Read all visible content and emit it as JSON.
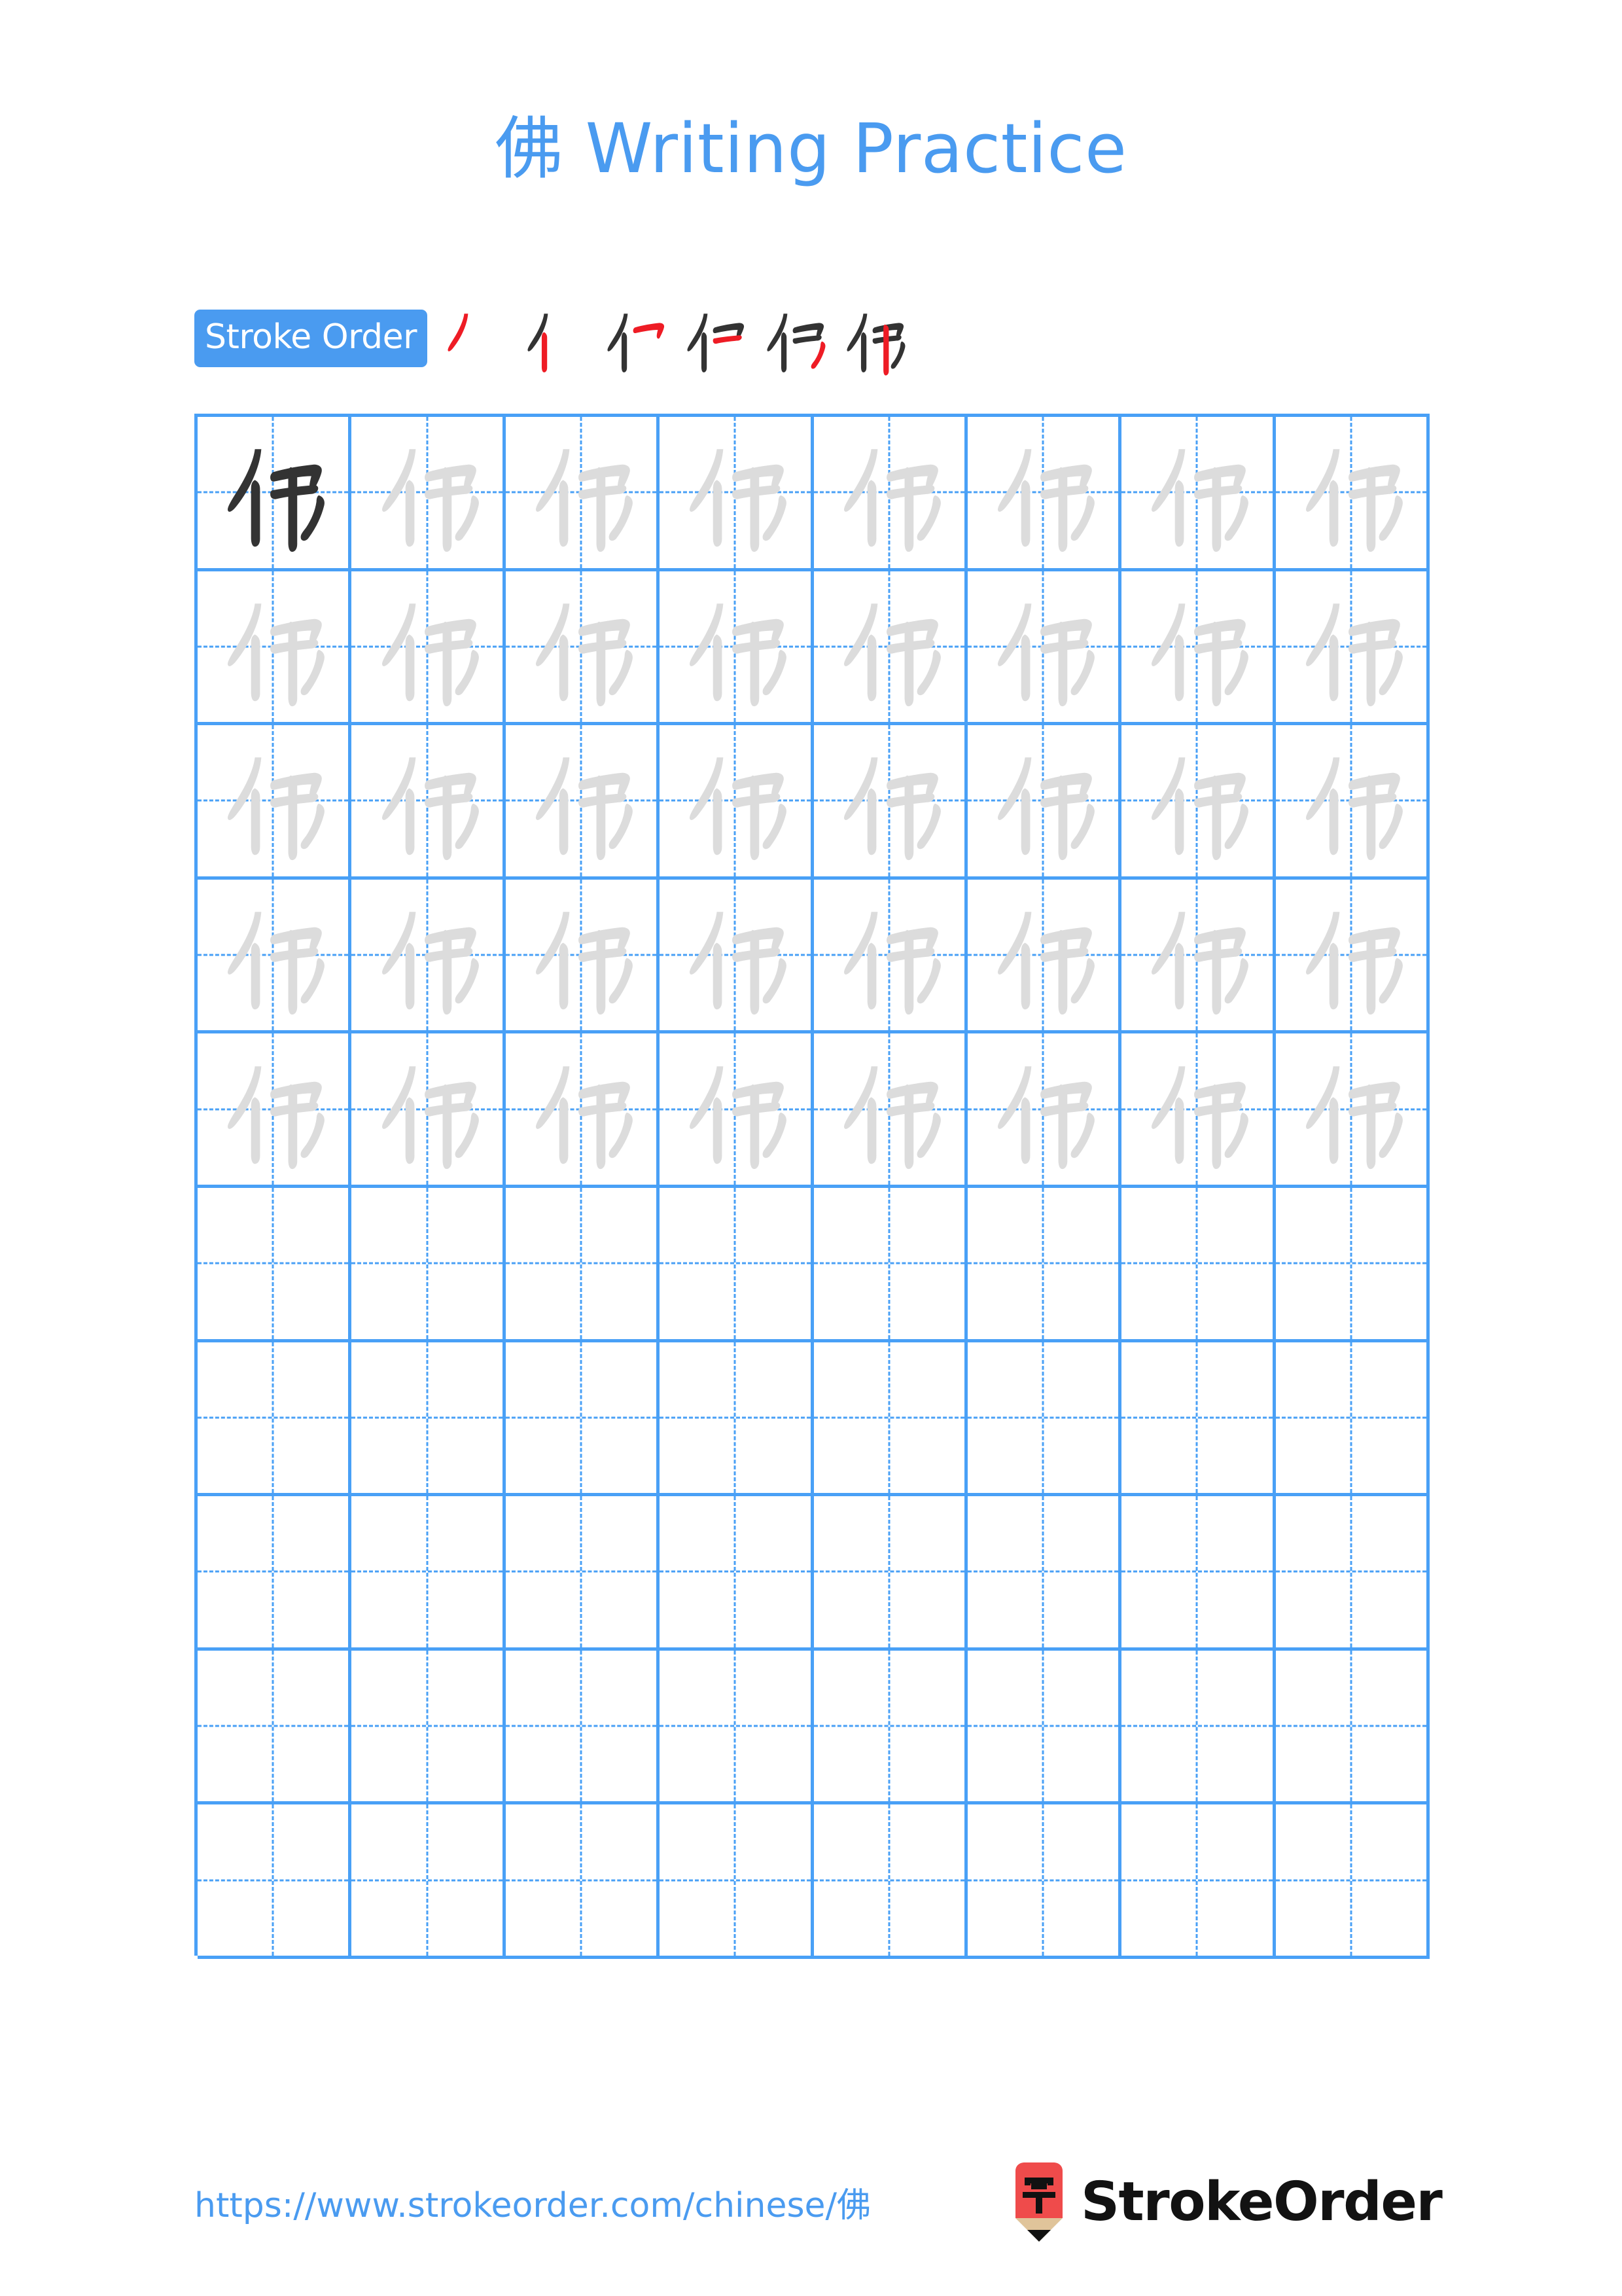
{
  "page": {
    "character": "佛",
    "title": "佛 Writing Practice",
    "title_color": "#4a9bf0",
    "background": "#ffffff"
  },
  "stroke_order": {
    "badge_label": "Stroke Order",
    "badge_background": "#4a9bf0",
    "badge_text_color": "#ffffff",
    "stroke_count": 6,
    "new_stroke_color": "#ee1c25",
    "prior_stroke_color": "#333333",
    "steps": [
      {
        "index": 1,
        "label": "stroke-1"
      },
      {
        "index": 2,
        "label": "stroke-2"
      },
      {
        "index": 3,
        "label": "stroke-3"
      },
      {
        "index": 4,
        "label": "stroke-4"
      },
      {
        "index": 5,
        "label": "stroke-5"
      },
      {
        "index": 6,
        "label": "stroke-6"
      }
    ]
  },
  "grid": {
    "columns": 8,
    "rows": 10,
    "line_color": "#49a0f6",
    "guide_style": "dashed-cross",
    "model_char_color": "#333333",
    "trace_char_color": "#dcdcdc",
    "rows_data": [
      {
        "row": 1,
        "cells": [
          "model",
          "trace",
          "trace",
          "trace",
          "trace",
          "trace",
          "trace",
          "trace"
        ]
      },
      {
        "row": 2,
        "cells": [
          "trace",
          "trace",
          "trace",
          "trace",
          "trace",
          "trace",
          "trace",
          "trace"
        ]
      },
      {
        "row": 3,
        "cells": [
          "trace",
          "trace",
          "trace",
          "trace",
          "trace",
          "trace",
          "trace",
          "trace"
        ]
      },
      {
        "row": 4,
        "cells": [
          "trace",
          "trace",
          "trace",
          "trace",
          "trace",
          "trace",
          "trace",
          "trace"
        ]
      },
      {
        "row": 5,
        "cells": [
          "trace",
          "trace",
          "trace",
          "trace",
          "trace",
          "trace",
          "trace",
          "trace"
        ]
      },
      {
        "row": 6,
        "cells": [
          "empty",
          "empty",
          "empty",
          "empty",
          "empty",
          "empty",
          "empty",
          "empty"
        ]
      },
      {
        "row": 7,
        "cells": [
          "empty",
          "empty",
          "empty",
          "empty",
          "empty",
          "empty",
          "empty",
          "empty"
        ]
      },
      {
        "row": 8,
        "cells": [
          "empty",
          "empty",
          "empty",
          "empty",
          "empty",
          "empty",
          "empty",
          "empty"
        ]
      },
      {
        "row": 9,
        "cells": [
          "empty",
          "empty",
          "empty",
          "empty",
          "empty",
          "empty",
          "empty",
          "empty"
        ]
      },
      {
        "row": 10,
        "cells": [
          "empty",
          "empty",
          "empty",
          "empty",
          "empty",
          "empty",
          "empty",
          "empty"
        ]
      }
    ]
  },
  "footer": {
    "url": "https://www.strokeorder.com/chinese/佛",
    "url_color": "#4a9bf0",
    "brand_name": "StrokeOrder",
    "brand_mark_char": "字",
    "brand_mark_color": "#ef4b4b",
    "brand_mark_wood_color": "#e0c49a",
    "brand_mark_tip_color": "#111111"
  }
}
